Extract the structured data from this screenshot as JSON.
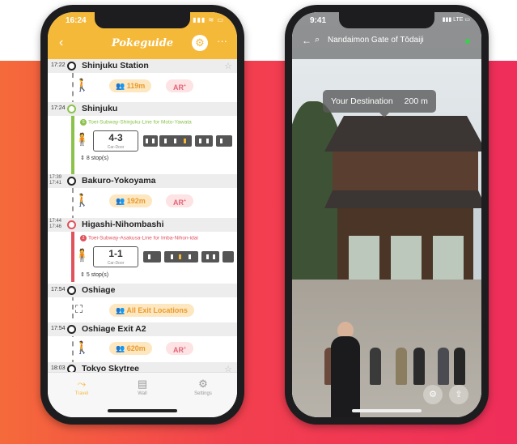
{
  "left_phone": {
    "status": {
      "time": "16:24",
      "signal": "▮▮▮ ≋ ▭"
    },
    "header": {
      "back_icon": "chevron-left-icon",
      "brand": "Pokeguide",
      "more_label": "···"
    },
    "stations": [
      {
        "time": "17:22",
        "name": "Shinjuku Station",
        "starred": true
      },
      {
        "time": "17:24",
        "name": "Shinjuku"
      },
      {
        "time_arr": "17:39",
        "time_dep": "17:41",
        "name": "Bakuro-Yokoyama"
      },
      {
        "time_arr": "17:44",
        "time_dep": "17:46",
        "name": "Higashi-Nihombashi"
      },
      {
        "time": "17:54",
        "name": "Oshiage"
      },
      {
        "time": "17:54",
        "name": "Oshiage Exit A2"
      },
      {
        "time": "18:03",
        "name": "Tokyo Skytree",
        "starred": true
      }
    ],
    "walks": [
      {
        "distance": "119m",
        "ar": "AR"
      },
      {
        "distance": "192m",
        "ar": "AR"
      },
      {
        "distance": "620m",
        "ar": "AR"
      }
    ],
    "segments": [
      {
        "badge": "S",
        "line": "Toei-Subway-Shinjuku-Line for Moto-Yawata",
        "car_number": "4-3",
        "car_caption": "Car-Door",
        "stops": "8 stop(s)",
        "color": "#8bc34a"
      },
      {
        "badge": "2",
        "line": "Toei-Subway-Asakusa-Line for Imba-Nihon-idai",
        "car_number": "1-1",
        "car_caption": "Car-Door",
        "stops": "5 stop(s)",
        "color": "#e0525c"
      }
    ],
    "exit_locations": "All Exit Locations",
    "tabs": [
      {
        "label": "Travel",
        "icon": "walk-icon",
        "active": true
      },
      {
        "label": "Wall",
        "icon": "wallet-icon"
      },
      {
        "label": "Settings",
        "icon": "settings-icon"
      }
    ]
  },
  "right_phone": {
    "status": {
      "time": "9:41",
      "signal": "▮▮▮ LTE ▭"
    },
    "search_title": "Nandaimon Gate of Tōdaiji",
    "destination_label": "Your Destination",
    "destination_distance": "200 m"
  }
}
